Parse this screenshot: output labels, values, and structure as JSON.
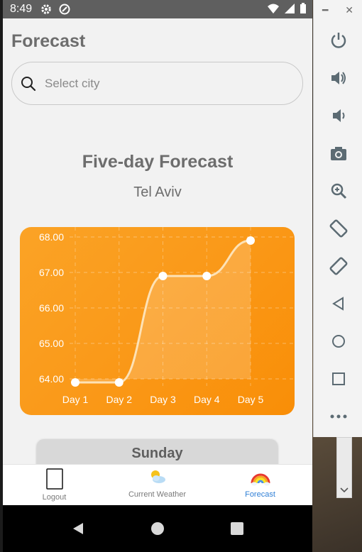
{
  "status_bar": {
    "time": "8:49"
  },
  "app": {
    "title": "Forecast",
    "search": {
      "placeholder": "Select city",
      "value": ""
    },
    "forecast_title": "Five-day Forecast",
    "city": "Tel Aviv",
    "day_card": "Sunday"
  },
  "chart_data": {
    "type": "line",
    "x": [
      "Day 1",
      "Day 2",
      "Day 3",
      "Day 4",
      "Day 5"
    ],
    "series": [
      {
        "values": [
          63.9,
          63.9,
          66.9,
          66.9,
          67.9
        ]
      }
    ],
    "yticks": [
      "64.00",
      "65.00",
      "66.00",
      "67.00",
      "68.00"
    ],
    "ylim": [
      64,
      68
    ],
    "grid": true,
    "line_color": "#fde2b6",
    "area_fill": "rgba(255,255,255,0.18)"
  },
  "bottom_nav": {
    "items": [
      {
        "label": "Logout",
        "icon": "logout-phone-icon",
        "active": false
      },
      {
        "label": "Current Weather",
        "icon": "sun-behind-cloud-icon",
        "active": false
      },
      {
        "label": "Forecast",
        "icon": "rainbow-icon",
        "active": true
      }
    ]
  },
  "emulator_toolbar": {
    "buttons": [
      "power-icon",
      "volume-up-icon",
      "volume-down-icon",
      "camera-icon",
      "zoom-icon",
      "rotate-left-icon",
      "rotate-right-icon",
      "back-icon",
      "home-icon",
      "overview-icon",
      "more-icon"
    ]
  },
  "colors": {
    "chart_bg": "#fa9a1a",
    "accent": "#2f7fd6",
    "text_gray": "#6d6d6d"
  }
}
